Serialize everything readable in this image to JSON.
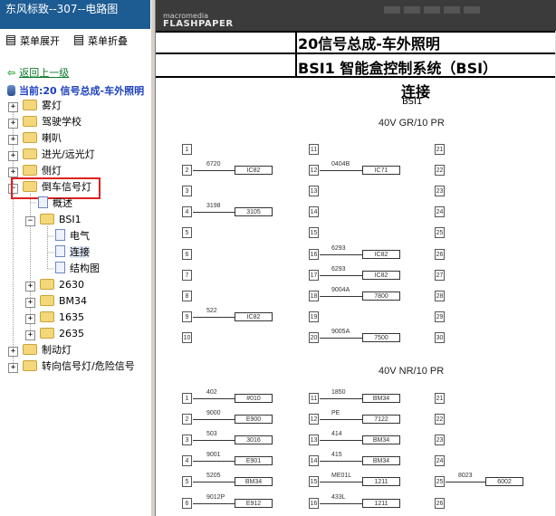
{
  "window_title": "东风标致--307--电路图",
  "toolbar": {
    "expand_label": "菜单展开",
    "collapse_label": "菜单折叠"
  },
  "back_label": "返回上一级",
  "current_label": "当前:20 信号总成-车外照明",
  "tree": [
    {
      "label": "雾灯"
    },
    {
      "label": "驾驶学校"
    },
    {
      "label": "喇叭"
    },
    {
      "label": "进光/远光灯"
    },
    {
      "label": "侧灯"
    },
    {
      "label": "倒车信号灯",
      "expanded": true
    },
    {
      "label": "概述"
    },
    {
      "label": "BSI1",
      "expanded": true
    },
    {
      "label": "电气"
    },
    {
      "label": "连接",
      "selected": true
    },
    {
      "label": "结构图"
    },
    {
      "label": "2630"
    },
    {
      "label": "BM34"
    },
    {
      "label": "1635"
    },
    {
      "label": "2635"
    },
    {
      "label": "制动灯"
    },
    {
      "label": "转向信号灯/危险信号"
    }
  ],
  "viewer": {
    "logo_small": "macromedia",
    "logo_big": "FLASHPAPER",
    "title1": "20信号总成-车外照明",
    "title2": "BSI1 智能盒控制系统（BSI）",
    "title3": "连接",
    "sub_bsi": "BSI1",
    "connector1": "40V GR/10 PR",
    "connector2": "40V NR/10 PR",
    "c1_rows": [
      {
        "p1": "1",
        "w1": "",
        "b1": "",
        "p2": "11",
        "w2": "",
        "b2": "",
        "p3": "21"
      },
      {
        "p1": "2",
        "w1": "6720",
        "b1": "IC82",
        "p2": "12",
        "w2": "0404B",
        "b2": "IC71",
        "p3": "22"
      },
      {
        "p1": "3",
        "w1": "",
        "b1": "",
        "p2": "13",
        "w2": "",
        "b2": "",
        "p3": "23"
      },
      {
        "p1": "4",
        "w1": "3198",
        "b1": "3105",
        "p2": "14",
        "w2": "",
        "b2": "",
        "p3": "24"
      },
      {
        "p1": "5",
        "w1": "",
        "b1": "",
        "p2": "15",
        "w2": "",
        "b2": "",
        "p3": "25"
      },
      {
        "p1": "6",
        "w1": "",
        "b1": "",
        "p2": "16",
        "w2": "6293",
        "b2": "IC82",
        "p3": "26"
      },
      {
        "p1": "7",
        "w1": "",
        "b1": "",
        "p2": "17",
        "w2": "6293",
        "b2": "IC82",
        "p3": "27"
      },
      {
        "p1": "8",
        "w1": "",
        "b1": "",
        "p2": "18",
        "w2": "9004A",
        "b2": "7800",
        "p3": "28"
      },
      {
        "p1": "9",
        "w1": "522",
        "b1": "IC82",
        "p2": "19",
        "w2": "",
        "b2": "",
        "p3": "29"
      },
      {
        "p1": "10",
        "w1": "",
        "b1": "",
        "p2": "20",
        "w2": "9005A",
        "b2": "7500",
        "p3": "30"
      }
    ],
    "c2_rows": [
      {
        "p1": "1",
        "w1": "402",
        "b1": "#010",
        "p2": "11",
        "w2": "1850",
        "b2": "BM34",
        "p3": "21"
      },
      {
        "p1": "2",
        "w1": "9000",
        "b1": "E900",
        "p2": "12",
        "w2": "PE",
        "b2": "7122",
        "p3": "22"
      },
      {
        "p1": "3",
        "w1": "503",
        "b1": "3016",
        "p2": "13",
        "w2": "414",
        "b2": "BM34",
        "p3": "23"
      },
      {
        "p1": "4",
        "w1": "9001",
        "b1": "E901",
        "p2": "14",
        "w2": "415",
        "b2": "BM34",
        "p3": "24"
      },
      {
        "p1": "5",
        "w1": "5205",
        "b1": "BM34",
        "p2": "15",
        "w2": "ME01L",
        "b2": "1211",
        "p3": "25"
      },
      {
        "p1": "6",
        "w1": "9012P",
        "b1": "E912",
        "p2": "16",
        "w2": "433L",
        "b2": "1211",
        "p3": "26"
      }
    ],
    "c2_extra": {
      "wire": "8023",
      "box": "6002"
    }
  }
}
